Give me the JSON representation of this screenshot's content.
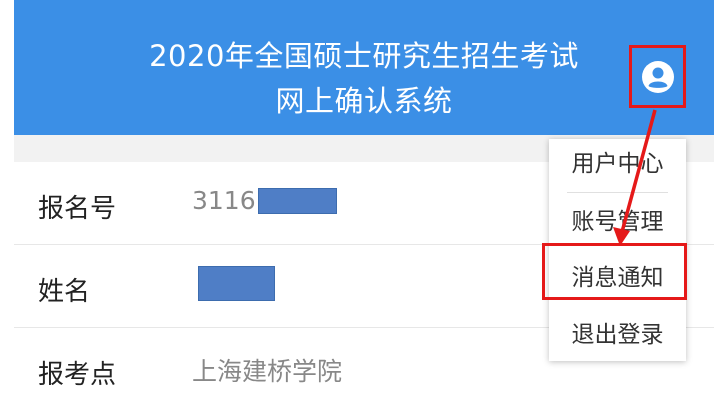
{
  "header": {
    "title_line1": "2020年全国硕士研究生招生考试",
    "title_line2": "网上确认系统",
    "background_color": "#3b8fe6",
    "user_icon": "user-circle-icon"
  },
  "info_rows": [
    {
      "label": "报名号",
      "value": "3116"
    },
    {
      "label": "姓名",
      "value": ""
    },
    {
      "label": "报考点",
      "value": "上海建桥学院"
    }
  ],
  "dropdown_menu": {
    "items": [
      {
        "label": "用户中心"
      },
      {
        "label": "账号管理"
      },
      {
        "label": "消息通知"
      },
      {
        "label": "退出登录"
      }
    ],
    "highlighted_item": "消息通知"
  },
  "annotation": {
    "color": "#e51919"
  }
}
